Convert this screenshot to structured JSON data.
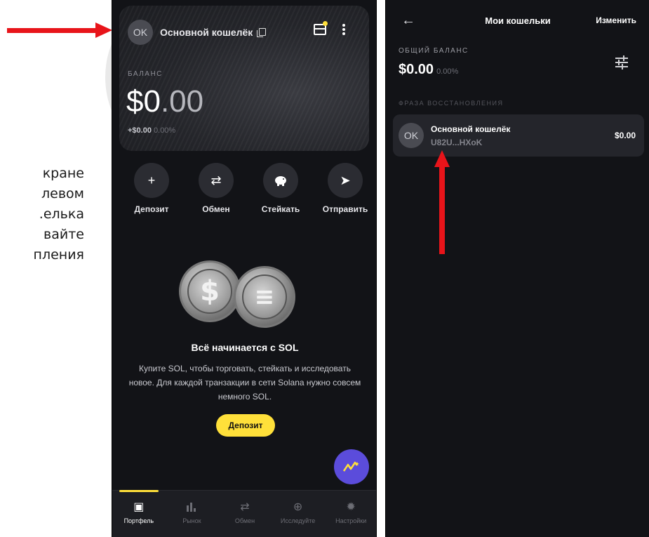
{
  "side_text": {
    "lines": [
      "кране",
      "левом",
      "елька.",
      "вайте",
      "пления"
    ]
  },
  "left_screen": {
    "card": {
      "avatar_initials": "OK",
      "wallet_name": "Основной кошелёк",
      "balance_label": "БАЛАНС",
      "balance_whole": "$0",
      "balance_cents": ".00",
      "change_value": "+$0.00",
      "change_percent": "0.00%"
    },
    "actions": [
      {
        "label": "Депозит",
        "icon": "plus-icon",
        "glyph": "+"
      },
      {
        "label": "Обмен",
        "icon": "swap-icon",
        "glyph": "⇄"
      },
      {
        "label": "Стейкать",
        "icon": "piggy-bank-icon",
        "glyph": "🐖"
      },
      {
        "label": "Отправить",
        "icon": "send-icon",
        "glyph": "➤"
      }
    ],
    "promo": {
      "title": "Всё начинается с SOL",
      "text": "Купите SOL, чтобы торговать, стейкать и исследовать новое. Для каждой транзакции в сети Solana нужно совсем немного SOL.",
      "button": "Депозит",
      "coin_symbols": [
        "$",
        "≡"
      ]
    },
    "tabs": [
      {
        "label": "Портфель",
        "icon": "portfolio-icon",
        "glyph": "▣",
        "active": true
      },
      {
        "label": "Рынок",
        "icon": "market-chart-icon",
        "glyph": "▮",
        "active": false
      },
      {
        "label": "Обмен",
        "icon": "swap-icon",
        "glyph": "⇄",
        "active": false
      },
      {
        "label": "Исследуйте",
        "icon": "globe-icon",
        "glyph": "⊕",
        "active": false
      },
      {
        "label": "Настройки",
        "icon": "gear-icon",
        "glyph": "✹",
        "active": false
      }
    ],
    "colors": {
      "accent": "#ffe03a",
      "fab": "#5b4cdb",
      "background": "#121317"
    }
  },
  "right_screen": {
    "back_glyph": "←",
    "title": "Мои кошельки",
    "edit": "Изменить",
    "total_label": "ОБЩИЙ БАЛАНС",
    "total_value": "$0.00",
    "total_percent": "0.00%",
    "section_label": "ФРАЗА ВОССТАНОВЛЕНИЯ",
    "wallet": {
      "avatar_initials": "OK",
      "name": "Основной кошелёк",
      "address": "U82U...HXoK",
      "amount": "$0.00"
    }
  },
  "annotations": {
    "arrow_color": "#e8141a"
  }
}
